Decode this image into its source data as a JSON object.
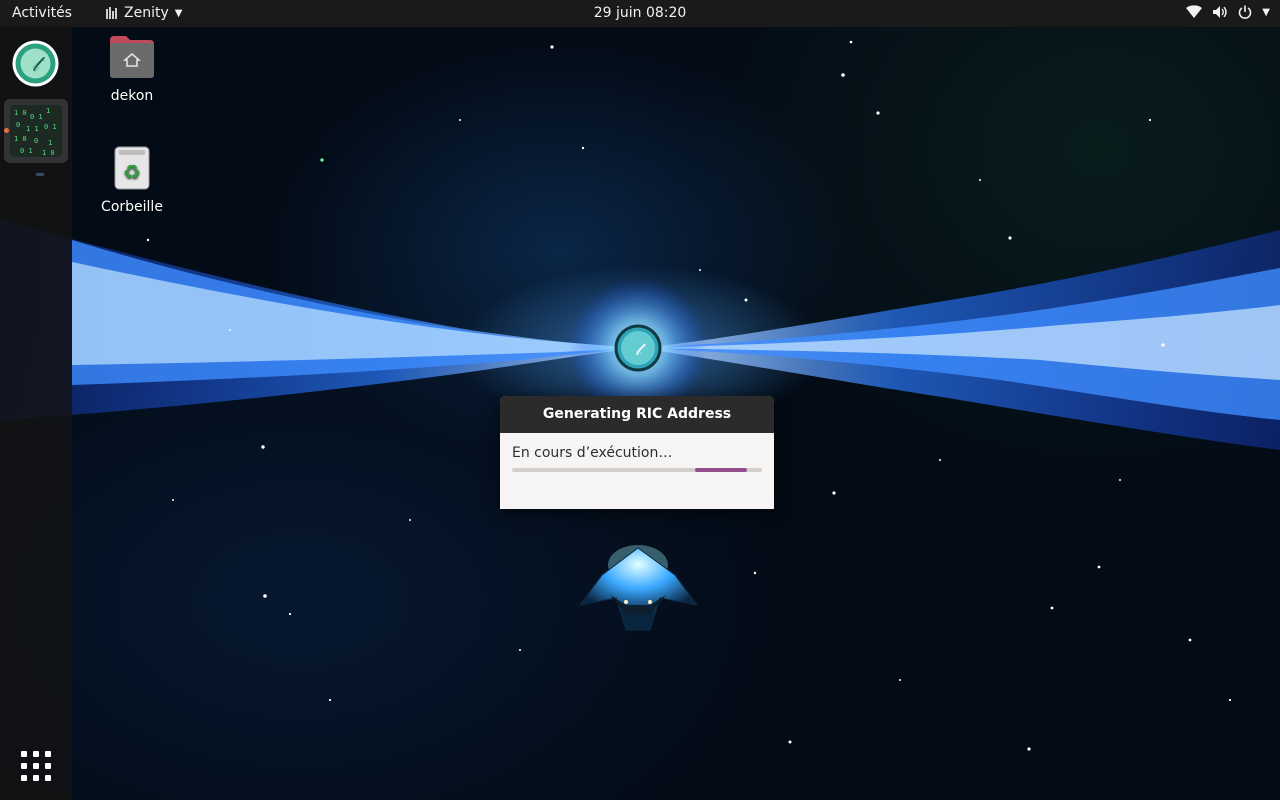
{
  "topbar": {
    "activities_label": "Activités",
    "app_menu_label": "Zenity",
    "clock": "29 juin  08:20",
    "tray_icons": [
      "wifi-icon",
      "volume-icon",
      "power-icon"
    ]
  },
  "dock": {
    "apps": [
      {
        "name": "round-logo-app-icon"
      },
      {
        "name": "matrix-terminal-app-icon",
        "running": true
      }
    ],
    "show_apps_icon": "grid-icon"
  },
  "desktop": {
    "icons": [
      {
        "label": "dekon",
        "icon": "home-folder-icon"
      },
      {
        "label": "Corbeille",
        "icon": "trash-icon"
      }
    ]
  },
  "dialog": {
    "title": "Generating RIC Address",
    "status_text": "En cours d’exécution…",
    "progress": {
      "mode": "pulsing",
      "indicator_start": 0.73,
      "indicator_end": 0.94
    },
    "accent_color": "#924d8b"
  },
  "colors": {
    "topbar_bg": "#1a1a1a",
    "dock_running_dot": "#e95420",
    "dialog_title_bg": "#2b2b2b"
  }
}
